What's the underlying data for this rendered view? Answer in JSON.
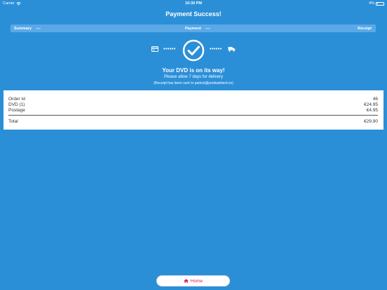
{
  "status_bar": {
    "carrier": "Carrier",
    "time": "10:30 PM",
    "battery": "4%",
    "battery_level": 0.04,
    "wifi_icon": "wifi-icon",
    "battery_icon": "battery-icon"
  },
  "header": {
    "title": "Payment Success!"
  },
  "steps": {
    "summary": "Summary",
    "payment": "Payment",
    "receipt": "Receipt",
    "dash": "-----"
  },
  "progress": {
    "card_icon": "credit-card-icon",
    "check_icon": "checkmark-circle-icon",
    "truck_icon": "truck-icon",
    "dots": "••••••"
  },
  "message": {
    "title": "Your DVD is on its way!",
    "subtitle": "Please allow 7 days for delivery",
    "receipt": "(Receipt has been sent to patrick@pmdwebtech.ie)"
  },
  "summary": {
    "rows": [
      {
        "label": "Order Id",
        "value": "46"
      },
      {
        "label": "DVD (1)",
        "value": "€24.95"
      },
      {
        "label": "Postage",
        "value": "€4.95"
      }
    ],
    "total_label": "Total",
    "total_value": "€29.90"
  },
  "home_button": {
    "label": "Home",
    "icon": "home-icon"
  },
  "colors": {
    "background": "#2b8fd8",
    "step_bar": "#5aa9e6",
    "accent": "#d81b60"
  }
}
